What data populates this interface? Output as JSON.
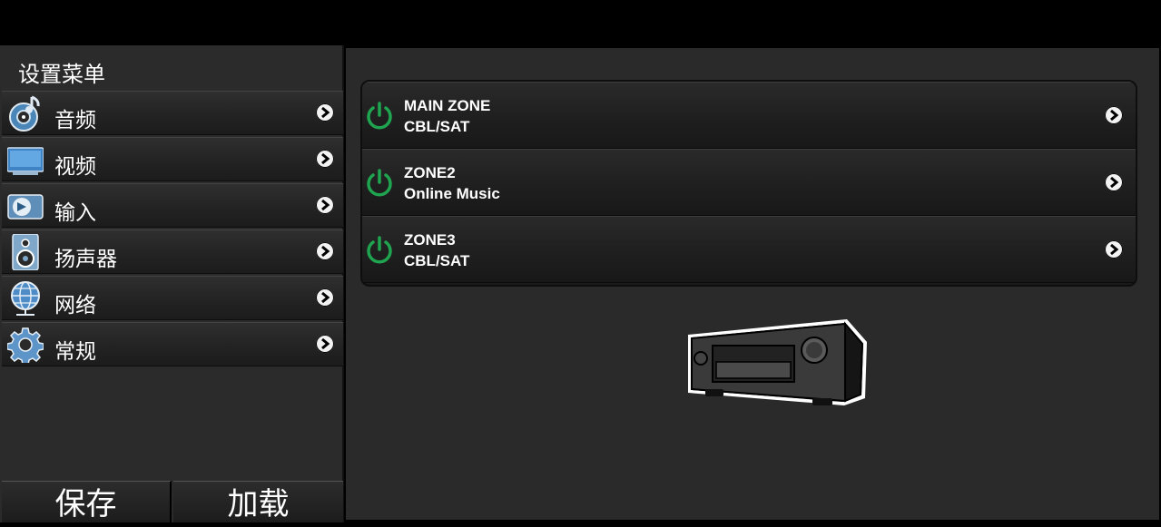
{
  "sidebar": {
    "title": "设置菜单",
    "items": [
      {
        "label": "音频",
        "icon": "speaker-cd-icon"
      },
      {
        "label": "视频",
        "icon": "monitor-icon"
      },
      {
        "label": "输入",
        "icon": "input-arrow-icon"
      },
      {
        "label": "扬声器",
        "icon": "loudspeaker-icon"
      },
      {
        "label": "网络",
        "icon": "globe-network-icon"
      },
      {
        "label": "常规",
        "icon": "gear-icon"
      }
    ],
    "buttons": {
      "save": "保存",
      "load": "加载"
    }
  },
  "zones": [
    {
      "name": "MAIN ZONE",
      "source": "CBL/SAT",
      "power_on": true
    },
    {
      "name": "ZONE2",
      "source": "Online Music",
      "power_on": true
    },
    {
      "name": "ZONE3",
      "source": "CBL/SAT",
      "power_on": true
    }
  ],
  "colors": {
    "power_green": "#1fa44f",
    "text": "#ffffff",
    "panel": "#2a2a2a"
  },
  "image": {
    "icon": "av-receiver-icon"
  }
}
